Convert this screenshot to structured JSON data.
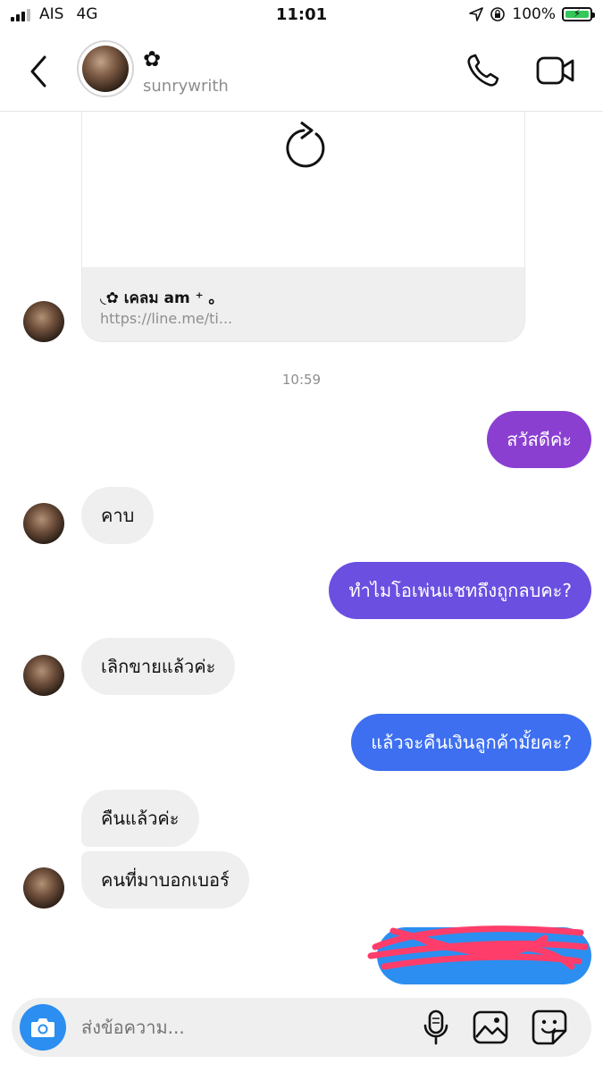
{
  "status": {
    "carrier": "AIS",
    "network": "4G",
    "time": "11:01",
    "battery": "100%",
    "battery_level": 1.0,
    "signal_bars": 3
  },
  "header": {
    "name": "✿",
    "username": "sunrywrith"
  },
  "link_card": {
    "title": "◟✿ เคลม am ⁺ ｡",
    "url": "https://line.me/ti..."
  },
  "timestamp": "10:59",
  "messages": [
    {
      "from": "me",
      "text": "สวัสดีค่ะ",
      "color": "#8a3fd1"
    },
    {
      "from": "them",
      "text": "คาบ"
    },
    {
      "from": "me",
      "text": "ทำไมโอเพ่นแชทถึงถูกลบคะ?",
      "color": "#6a4fe0"
    },
    {
      "from": "them",
      "text": "เลิกขายแล้วค่ะ"
    },
    {
      "from": "me",
      "text": "แล้วจะคืนเงินลูกค้ามั้ยคะ?",
      "color": "#3d6ff0"
    },
    {
      "from": "them",
      "text": "คืนแล้วค่ะ"
    },
    {
      "from": "them",
      "text": "คนที่มาบอกเบอร์"
    },
    {
      "from": "me",
      "text": "",
      "color": "#2b8ef0",
      "redacted": true
    }
  ],
  "composer": {
    "placeholder": "ส่งข้อความ..."
  },
  "colors": {
    "bubble_in": "#efefef",
    "camera": "#2b8ef0",
    "redaction": "#ff3d6a"
  }
}
